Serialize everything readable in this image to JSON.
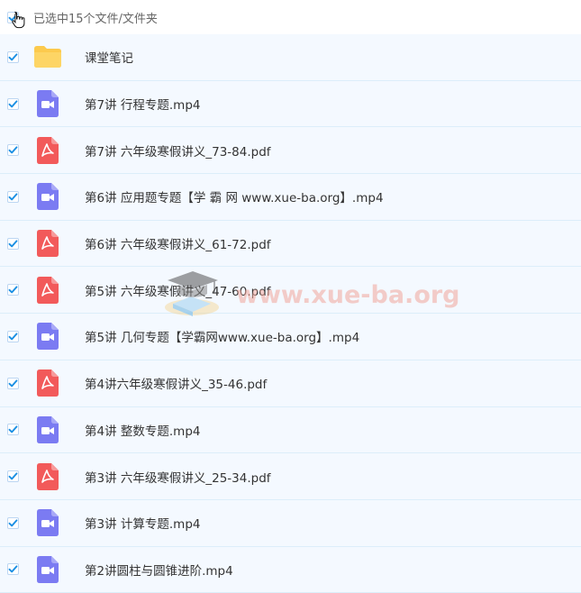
{
  "header": {
    "selection_text": "已选中15个文件/文件夹",
    "checked": true
  },
  "files": [
    {
      "name": "课堂笔记",
      "type": "folder",
      "icon": "folder-icon",
      "checked": true
    },
    {
      "name": "第7讲 行程专题.mp4",
      "type": "video",
      "icon": "video-file-icon",
      "checked": true
    },
    {
      "name": "第7讲 六年级寒假讲义_73-84.pdf",
      "type": "pdf",
      "icon": "pdf-file-icon",
      "checked": true
    },
    {
      "name": "第6讲 应用题专题【学 霸 网 www.xue-ba.org】.mp4",
      "type": "video",
      "icon": "video-file-icon",
      "checked": true
    },
    {
      "name": "第6讲 六年级寒假讲义_61-72.pdf",
      "type": "pdf",
      "icon": "pdf-file-icon",
      "checked": true
    },
    {
      "name": "第5讲 六年级寒假讲义_47-60.pdf",
      "type": "pdf",
      "icon": "pdf-file-icon",
      "checked": true
    },
    {
      "name": "第5讲 几何专题【学霸网www.xue-ba.org】.mp4",
      "type": "video",
      "icon": "video-file-icon",
      "checked": true
    },
    {
      "name": "第4讲六年级寒假讲义_35-46.pdf",
      "type": "pdf",
      "icon": "pdf-file-icon",
      "checked": true
    },
    {
      "name": "第4讲 整数专题.mp4",
      "type": "video",
      "icon": "video-file-icon",
      "checked": true
    },
    {
      "name": "第3讲 六年级寒假讲义_25-34.pdf",
      "type": "pdf",
      "icon": "pdf-file-icon",
      "checked": true
    },
    {
      "name": "第3讲 计算专题.mp4",
      "type": "video",
      "icon": "video-file-icon",
      "checked": true
    },
    {
      "name": "第2讲圆柱与圆锥进阶.mp4",
      "type": "video",
      "icon": "video-file-icon",
      "checked": true
    }
  ],
  "watermark": {
    "text": "www.xue-ba.org",
    "icon": "graduation-cap-icon"
  },
  "colors": {
    "check": "#1a8fe3",
    "folder": "#fcca4d",
    "video": "#7b7bf2",
    "pdf": "#f25a5a",
    "row_bg": "#f4f9ff"
  }
}
